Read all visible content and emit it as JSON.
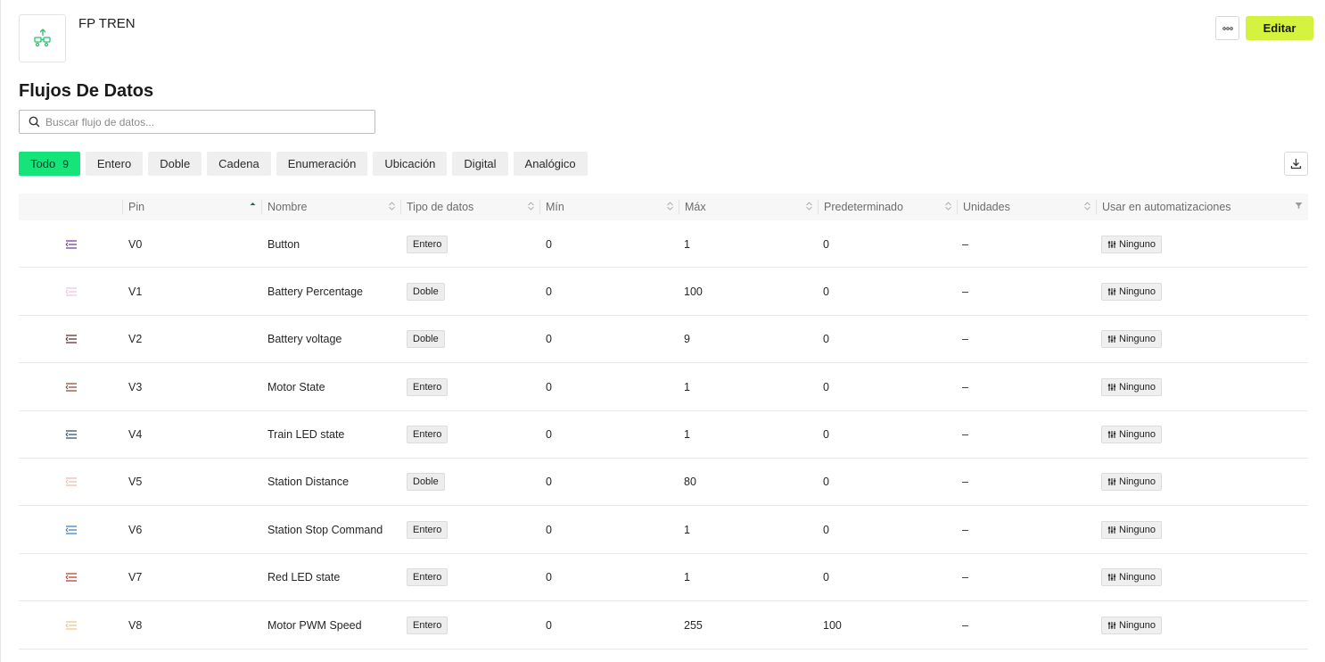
{
  "header": {
    "product_name": "FP TREN",
    "more_icon": "ellipsis-icon",
    "edit_label": "Editar",
    "accent_color": "#d5f23f"
  },
  "section": {
    "title": "Flujos De Datos"
  },
  "search": {
    "placeholder": "Buscar flujo de datos..."
  },
  "filters": [
    {
      "label": "Todo",
      "count": "9",
      "active": true
    },
    {
      "label": "Entero"
    },
    {
      "label": "Doble"
    },
    {
      "label": "Cadena"
    },
    {
      "label": "Enumeración"
    },
    {
      "label": "Ubicación"
    },
    {
      "label": "Digital"
    },
    {
      "label": "Analógico"
    }
  ],
  "table": {
    "columns": [
      "Pin",
      "Nombre",
      "Tipo de datos",
      "Mín",
      "Máx",
      "Predeterminado",
      "Unidades",
      "Usar en automatizaciones"
    ],
    "rows": [
      {
        "icon_color": "#6a3ea1",
        "pin": "V0",
        "name": "Button",
        "type": "Entero",
        "min": "0",
        "max": "1",
        "default": "0",
        "units": "–",
        "automation": "Ninguno"
      },
      {
        "icon_color": "#e9c4e8",
        "pin": "V1",
        "name": "Battery Percentage",
        "type": "Doble",
        "min": "0",
        "max": "100",
        "default": "0",
        "units": "–",
        "automation": "Ninguno"
      },
      {
        "icon_color": "#5a2a2a",
        "pin": "V2",
        "name": "Battery voltage",
        "type": "Doble",
        "min": "0",
        "max": "9",
        "default": "0",
        "units": "–",
        "automation": "Ninguno"
      },
      {
        "icon_color": "#8a4a2a",
        "pin": "V3",
        "name": "Motor State",
        "type": "Entero",
        "min": "0",
        "max": "1",
        "default": "0",
        "units": "–",
        "automation": "Ninguno"
      },
      {
        "icon_color": "#2e4e63",
        "pin": "V4",
        "name": "Train LED state",
        "type": "Entero",
        "min": "0",
        "max": "1",
        "default": "0",
        "units": "–",
        "automation": "Ninguno"
      },
      {
        "icon_color": "#f2b8b0",
        "pin": "V5",
        "name": "Station Distance",
        "type": "Doble",
        "min": "0",
        "max": "80",
        "default": "0",
        "units": "–",
        "automation": "Ninguno"
      },
      {
        "icon_color": "#3a7fc4",
        "pin": "V6",
        "name": "Station Stop Command",
        "type": "Entero",
        "min": "0",
        "max": "1",
        "default": "0",
        "units": "–",
        "automation": "Ninguno"
      },
      {
        "icon_color": "#c0392b",
        "pin": "V7",
        "name": "Red LED state",
        "type": "Entero",
        "min": "0",
        "max": "1",
        "default": "0",
        "units": "–",
        "automation": "Ninguno"
      },
      {
        "icon_color": "#f5c08a",
        "pin": "V8",
        "name": "Motor PWM Speed",
        "type": "Entero",
        "min": "0",
        "max": "255",
        "default": "100",
        "units": "–",
        "automation": "Ninguno"
      }
    ]
  }
}
